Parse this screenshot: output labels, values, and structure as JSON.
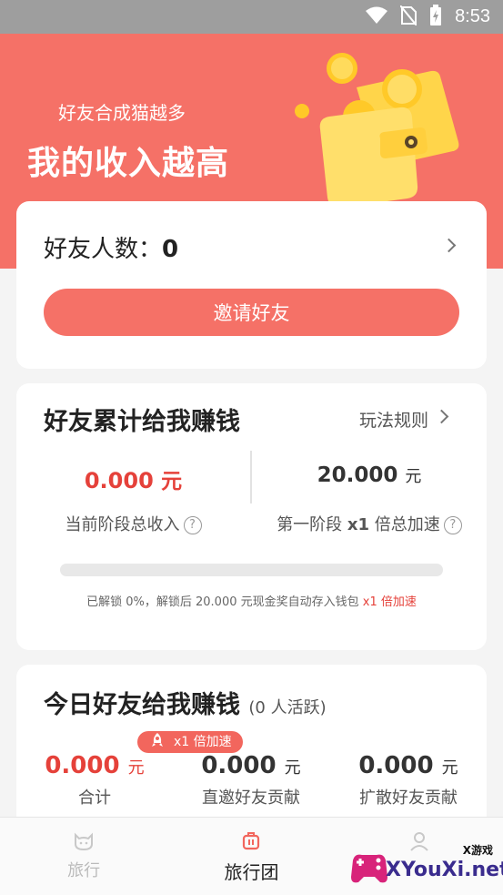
{
  "status_bar": {
    "time": "8:53"
  },
  "hero": {
    "subtitle": "好友合成猫越多",
    "title": "我的收入越高"
  },
  "friends_card": {
    "label": "好友人数：",
    "count": "0",
    "invite_button": "邀请好友"
  },
  "earn_card": {
    "title": "好友累计给我赚钱",
    "rules_link": "玩法规则",
    "current_amount": "0.000",
    "current_unit": "元",
    "current_label": "当前阶段总收入",
    "target_amount": "20.000",
    "target_unit": "元",
    "target_label_prefix": "第一阶段",
    "target_label_mult": "x1",
    "target_label_suffix": "倍总加速",
    "progress_fraction": 0.0,
    "note_main": "已解锁 0%，解锁后 20.000 元现金奖自动存入钱包",
    "note_highlight": "x1 倍加速",
    "help_glyph": "?"
  },
  "today_card": {
    "title": "今日好友给我赚钱",
    "active_text": "(0 人活跃)",
    "boost_tag": "x1 倍加速",
    "stats": [
      {
        "value": "0.000",
        "unit": "元",
        "label": "合计"
      },
      {
        "value": "0.000",
        "unit": "元",
        "label": "直邀好友贡献"
      },
      {
        "value": "0.000",
        "unit": "元",
        "label": "扩散好友贡献"
      }
    ]
  },
  "bottom_nav": {
    "items": [
      {
        "label": "旅行",
        "active": false
      },
      {
        "label": "旅行团",
        "active": true
      },
      {
        "label": "",
        "active": false
      }
    ]
  },
  "watermark": {
    "top": "X游戏",
    "site": "XYouXi.net"
  },
  "colors": {
    "accent": "#f57167",
    "red_text": "#e5413a"
  }
}
